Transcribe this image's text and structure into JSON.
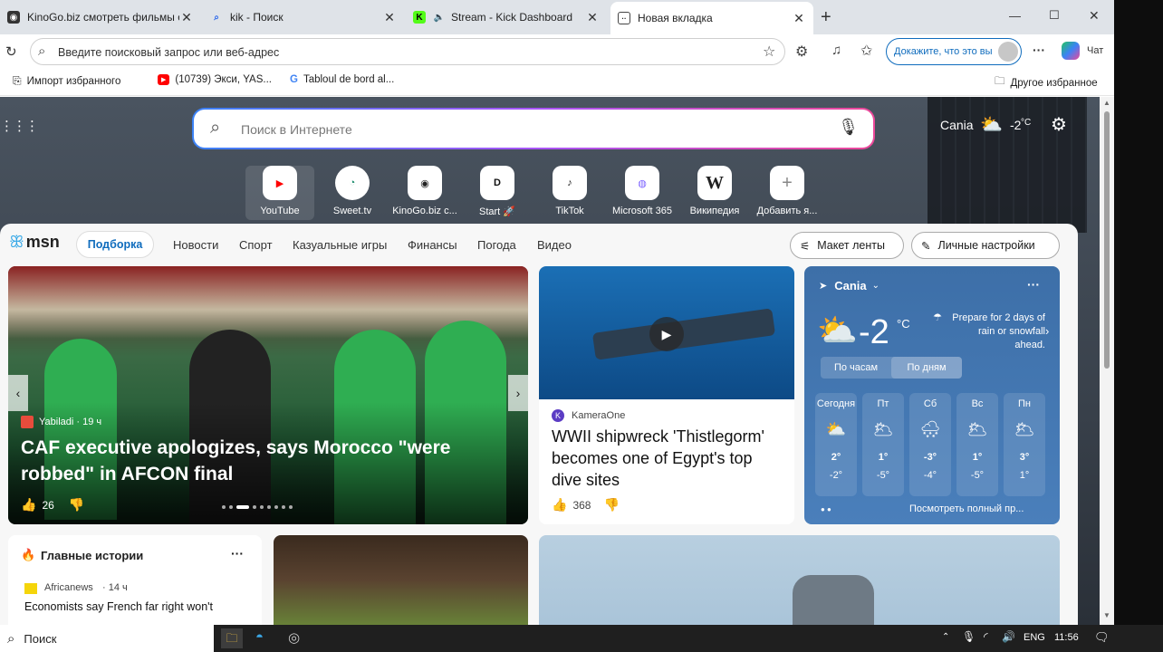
{
  "tabs": [
    {
      "title": "KinoGo.biz смотреть фильмы онлайн",
      "close": "✕"
    },
    {
      "title": "kik - Поиск",
      "close": "✕"
    },
    {
      "title": "Stream - Kick Dashboard",
      "close": "✕"
    },
    {
      "title": "Новая вкладка",
      "close": "✕"
    }
  ],
  "new_tab": "+",
  "window_controls": {
    "minimize": "—",
    "maximize": "☐",
    "close": "✕"
  },
  "address": {
    "placeholder": "Введите поисковый запрос или веб-адрес",
    "profile_label": "Докажите, что это вы",
    "chat_label": "Чат",
    "more": "···"
  },
  "bookmarks": [
    {
      "label": "Импорт избранного"
    },
    {
      "label": "(10739) Экси, YAS..."
    },
    {
      "label": "Tabloul de bord al..."
    }
  ],
  "other_favorites": "Другое избранное",
  "ntp": {
    "search_placeholder": "Поиск в Интернете",
    "location": "Cania",
    "temp": "-2",
    "temp_unit": "°C"
  },
  "quick_links": [
    {
      "label": "YouTube",
      "glyph": "▶",
      "color": "#ff0000"
    },
    {
      "label": "Sweet.tv",
      "glyph": "◔",
      "color": "#1a8a6a"
    },
    {
      "label": "KinoGo.biz с...",
      "glyph": "◉",
      "color": "#222"
    },
    {
      "label": "Start 🚀",
      "glyph": "D",
      "color": "#111"
    },
    {
      "label": "TikTok",
      "glyph": "♪",
      "color": "#111"
    },
    {
      "label": "Microsoft 365",
      "glyph": "◍",
      "color": "#7b61ff"
    },
    {
      "label": "Википедия",
      "glyph": "W",
      "color": "#222"
    },
    {
      "label": "Добавить я...",
      "glyph": "+",
      "color": "#888"
    }
  ],
  "msn": {
    "logo": "msn",
    "nav": [
      "Подборка",
      "Новости",
      "Спорт",
      "Казуальные игры",
      "Финансы",
      "Погода",
      "Видео"
    ],
    "layout_btn": "Макет ленты",
    "settings_btn": "Личные настройки"
  },
  "hero": {
    "source": "Yabiladi",
    "time": "· 19 ч",
    "title": "CAF executive apologizes, says Morocco \"were robbed\" in AFCON final",
    "likes": "26"
  },
  "story2": {
    "source": "KameraOne",
    "title": "WWII shipwreck 'Thistlegorm' becomes one of Egypt's top dive sites",
    "likes": "368"
  },
  "weather": {
    "location": "Cania",
    "temp": "-2",
    "unit": "°C",
    "alert": "Prepare for 2 days of rain or snowfall ahead.",
    "tab_hourly": "По часам",
    "tab_daily": "По дням",
    "days": [
      {
        "day": "Сегодня",
        "hi": "2°",
        "lo": "-2°"
      },
      {
        "day": "Пт",
        "hi": "1°",
        "lo": "-5°"
      },
      {
        "day": "Сб",
        "hi": "-3°",
        "lo": "-4°"
      },
      {
        "day": "Вс",
        "hi": "1°",
        "lo": "-5°"
      },
      {
        "day": "Пн",
        "hi": "3°",
        "lo": "1°"
      }
    ],
    "full_link": "Посмотреть полный пр..."
  },
  "top_stories": {
    "title": "Главные истории",
    "source": "Africanews",
    "time": "· 14 ч",
    "headline": "Economists say French far right won't"
  },
  "taskbar": {
    "search": "Поиск",
    "lang": "ENG",
    "time": "11:56"
  },
  "colors": {
    "accent": "#0f6cbd",
    "weather_bg": "#3a6fb0",
    "tabbar": "#dfe3e8"
  }
}
